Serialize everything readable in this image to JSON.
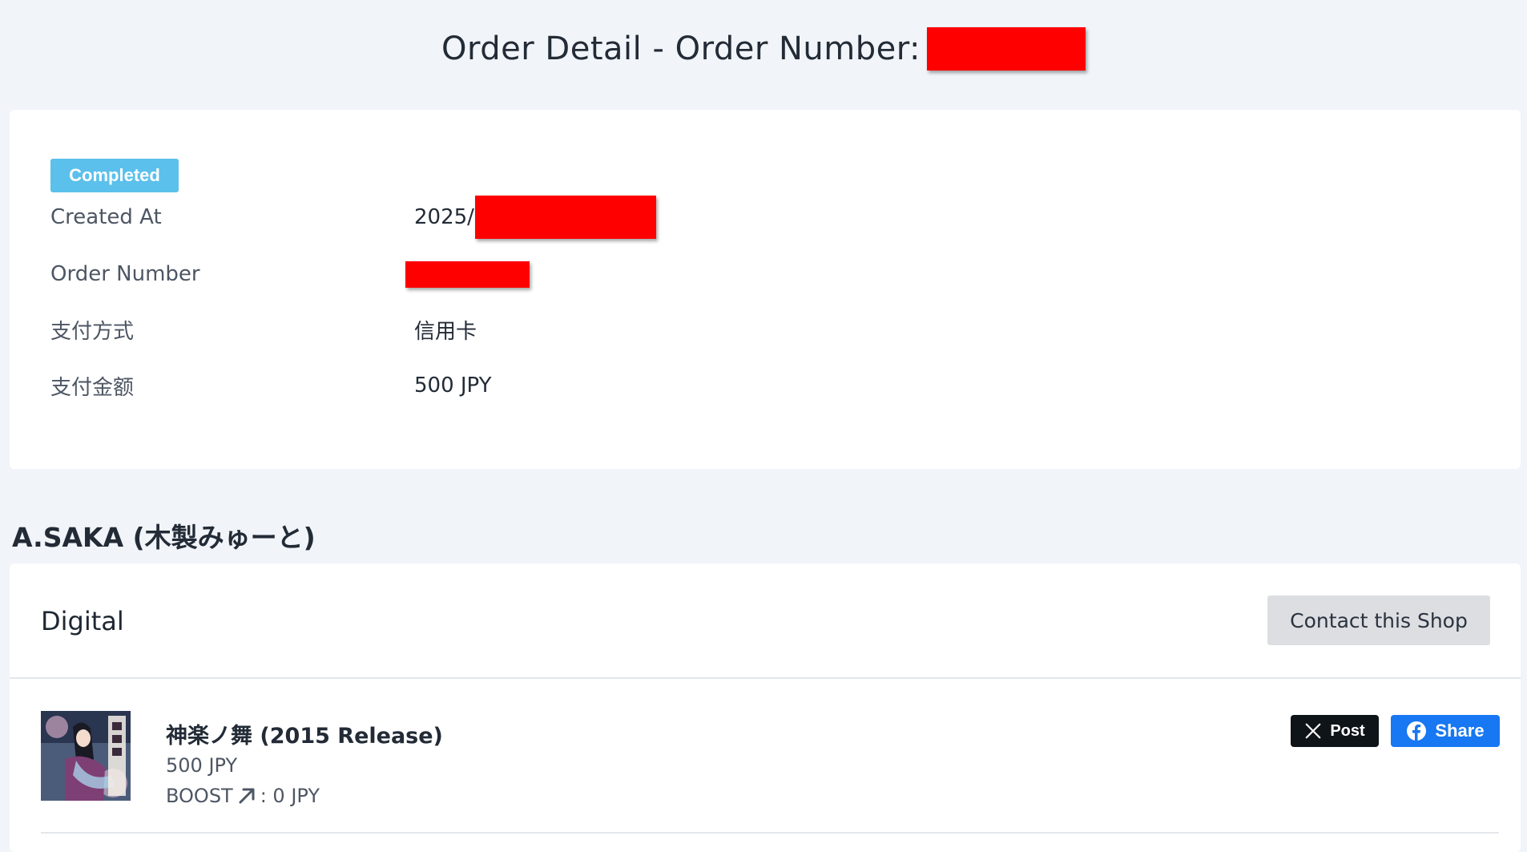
{
  "header": {
    "title": "Order Detail - Order Number:"
  },
  "order": {
    "status": "Completed",
    "rows": [
      {
        "label": "Created At",
        "value": "2025/"
      },
      {
        "label": "Order Number",
        "value": ""
      },
      {
        "label": "支付方式",
        "value": "信用卡"
      },
      {
        "label": "支付金额",
        "value": "500 JPY"
      }
    ]
  },
  "shop": {
    "name": "A.SAKA (木製みゅーと)",
    "section_title": "Digital",
    "contact_label": "Contact this Shop"
  },
  "product": {
    "name": "神楽ノ舞 (2015 Release)",
    "price": "500 JPY",
    "boost_prefix": "BOOST",
    "boost_suffix": ": 0 JPY",
    "post_label": "Post",
    "share_label": "Share"
  },
  "colors": {
    "status_badge": "#5bc0eb",
    "redaction": "#ff0000",
    "x_button": "#0f1419",
    "facebook_button": "#1877f2",
    "page_background": "#f1f4f8"
  },
  "icons": {
    "boost": "arrow-up-right-icon",
    "post": "x-logo-icon",
    "share": "facebook-logo-icon"
  }
}
